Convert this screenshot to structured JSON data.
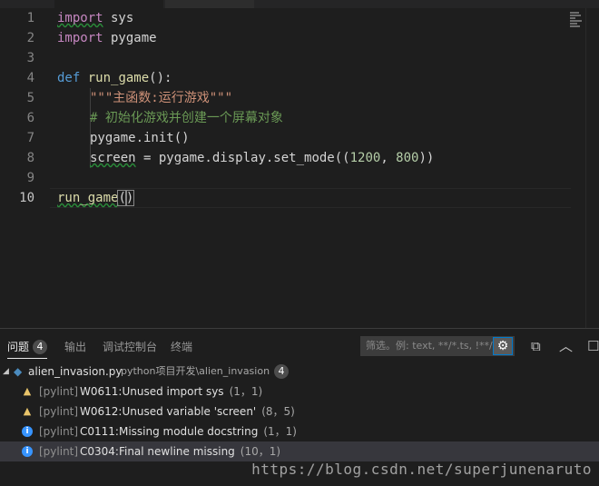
{
  "editor": {
    "line_numbers": [
      "1",
      "2",
      "3",
      "4",
      "5",
      "6",
      "7",
      "8",
      "9",
      "10"
    ],
    "lines": {
      "l1": {
        "kw": "import",
        "rest": " sys"
      },
      "l2": {
        "kw": "import",
        "rest": " pygame"
      },
      "l4": {
        "def": "def",
        "fn": " run_game",
        "rest": "():"
      },
      "l5": {
        "str": "\"\"\"主函数:运行游戏\"\"\""
      },
      "l6": {
        "cmt": "# 初始化游戏并创建一个屏幕对象"
      },
      "l7": {
        "a": "pygame.init()"
      },
      "l8": {
        "a": "screen",
        "b": " = pygame.display.set_mode((",
        "n1": "1200",
        "c": ", ",
        "n2": "800",
        "d": "))"
      },
      "l10": {
        "fn": "run_game",
        "open": "(",
        "close": ")"
      }
    }
  },
  "panel": {
    "tabs": [
      {
        "label": "问题",
        "count": "4"
      },
      {
        "label": "输出"
      },
      {
        "label": "调试控制台"
      },
      {
        "label": "终端"
      }
    ],
    "filter_placeholder": "筛选。例: text, **/*.ts, !**/...",
    "file": {
      "name": "alien_invasion.py",
      "path": "python项目开发\\alien_invasion",
      "count": "4"
    },
    "issues": [
      {
        "severity": "warning",
        "source": "[pylint]",
        "message": "W0611:Unused import sys",
        "location": "(1，1)"
      },
      {
        "severity": "warning",
        "source": "[pylint]",
        "message": "W0612:Unused variable 'screen'",
        "location": "(8，5)"
      },
      {
        "severity": "info",
        "source": "[pylint]",
        "message": "C0111:Missing module docstring",
        "location": "(1，1)"
      },
      {
        "severity": "info",
        "source": "[pylint]",
        "message": "C0304:Final newline missing",
        "location": "(10，1)"
      }
    ]
  },
  "watermark": "https://blog.csdn.net/superjunenaruto"
}
